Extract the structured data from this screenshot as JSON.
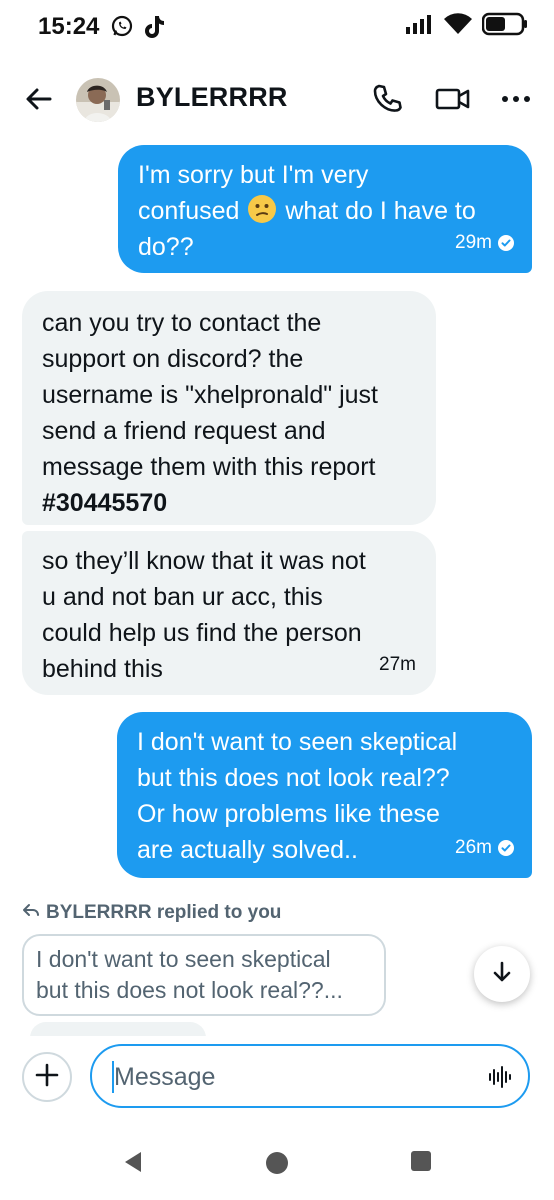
{
  "status_bar": {
    "time": "15:24",
    "battery_level": 0.55
  },
  "header": {
    "contact_name": "BYLERRRR"
  },
  "messages": [
    {
      "direction": "sent",
      "lines": [
        "I'm sorry but I'm very",
        "confused",
        "what do I have to",
        "do??"
      ],
      "time": "29m"
    },
    {
      "direction": "received",
      "lines": [
        "can you try to contact the",
        "support on discord? the",
        "username is \"xhelpronald\" just",
        "send a friend request and",
        "message them with this report",
        "#30445570"
      ]
    },
    {
      "direction": "received",
      "lines": [
        "so they’ll know that it was not",
        "u and not ban ur acc, this",
        "could help us find the person",
        "behind this"
      ],
      "time": "27m"
    },
    {
      "direction": "sent",
      "lines": [
        "I don't want to seen skeptical",
        "but this does not look real??",
        "Or how problems like these",
        "are actually solved.."
      ],
      "time": "26m"
    }
  ],
  "reply_preview": {
    "label": "BYLERRRR replied to you",
    "quote_lines": [
      "I don't want to seen skeptical",
      "but this does not look real??..."
    ]
  },
  "composer": {
    "placeholder": "Message"
  },
  "colors": {
    "accent": "#1d9bf0",
    "received_bubble": "#eff3f4",
    "text": "#0f1419",
    "muted": "#536471"
  }
}
